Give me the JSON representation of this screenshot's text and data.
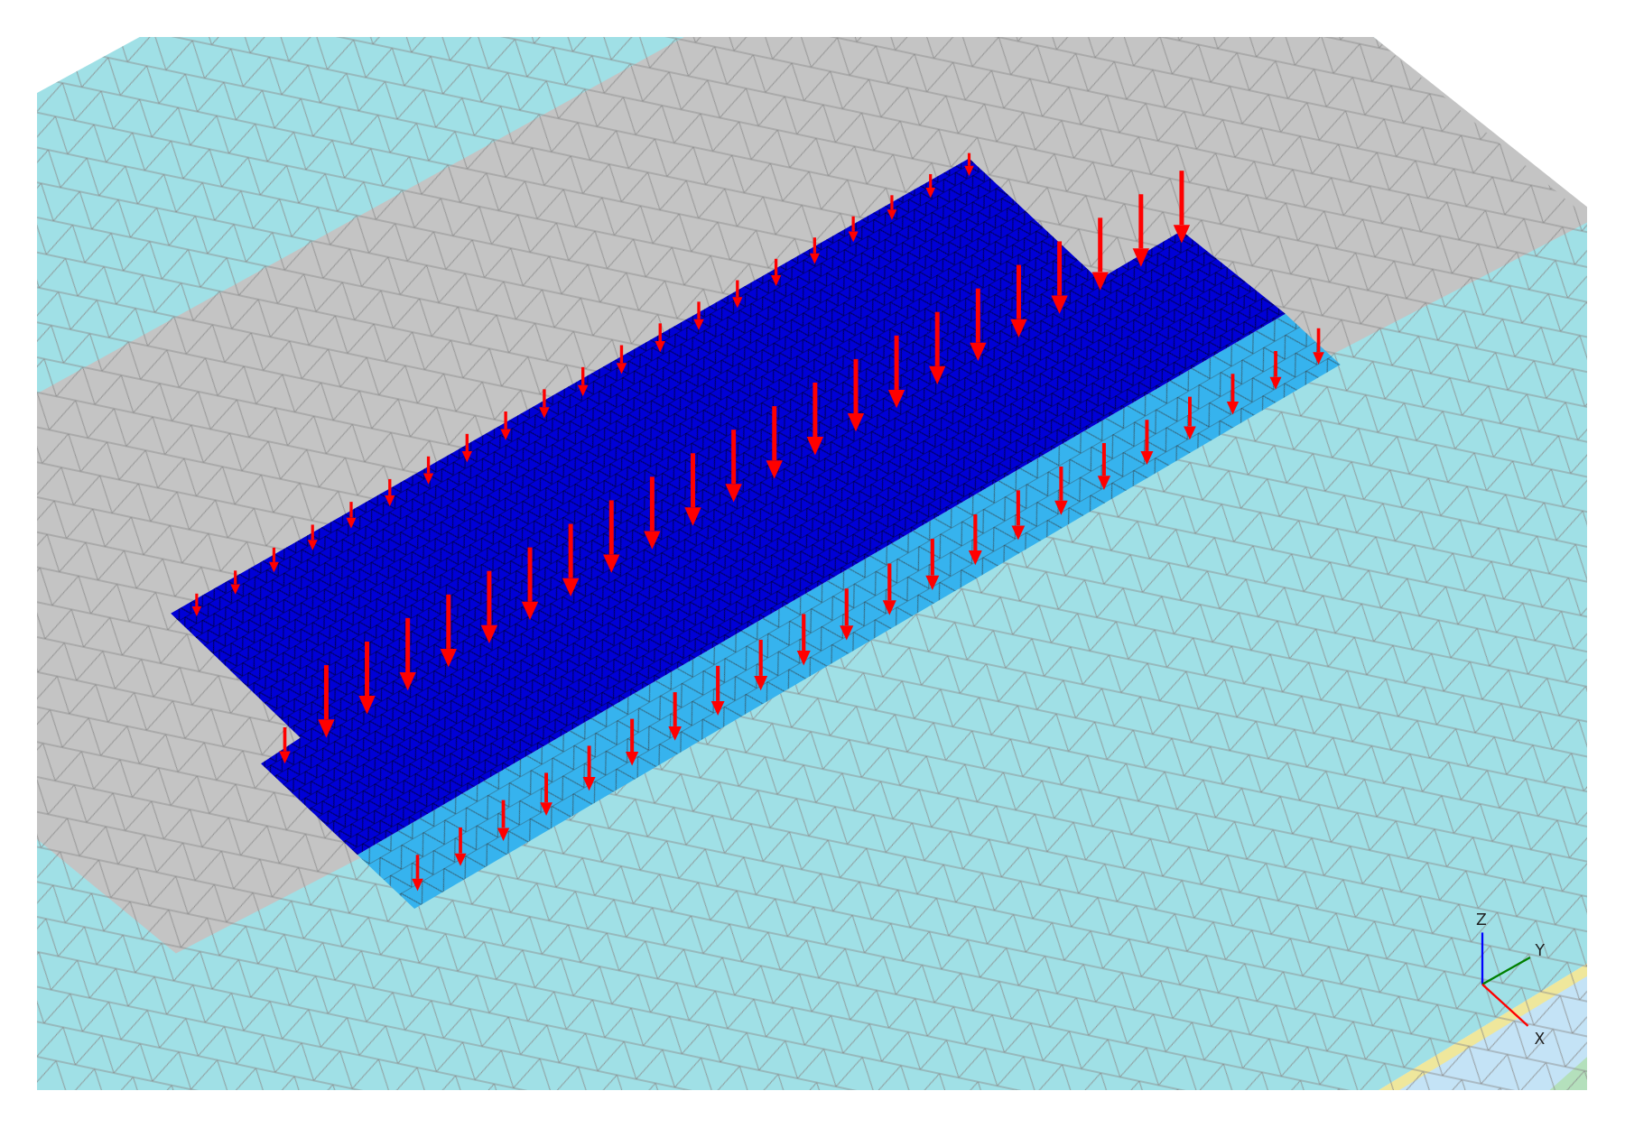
{
  "viewport": {
    "axes": [
      {
        "kind": "z",
        "label": "Z"
      },
      {
        "kind": "y",
        "label": "Y"
      },
      {
        "kind": "x",
        "label": "X"
      }
    ]
  }
}
